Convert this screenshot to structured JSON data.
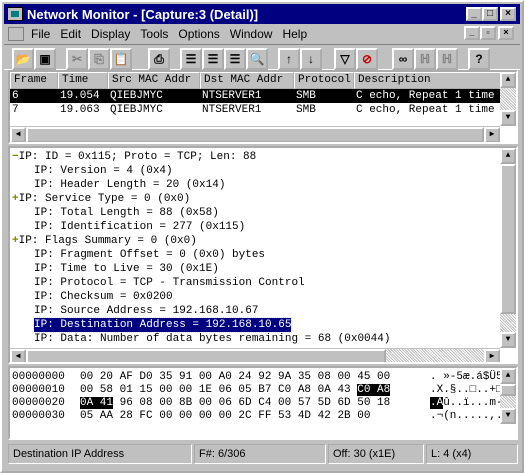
{
  "window": {
    "title": "Network Monitor - [Capture:3 (Detail)]"
  },
  "menu": [
    {
      "id": "file",
      "label": "File"
    },
    {
      "id": "edit",
      "label": "Edit"
    },
    {
      "id": "display",
      "label": "Display"
    },
    {
      "id": "tools",
      "label": "Tools"
    },
    {
      "id": "options",
      "label": "Options"
    },
    {
      "id": "window",
      "label": "Window"
    },
    {
      "id": "help",
      "label": "Help"
    }
  ],
  "toolbar_icons": [
    "open-icon",
    "save-icon",
    "cut-icon",
    "copy-icon",
    "paste-icon",
    "print-icon",
    "pane-summary-icon",
    "pane-detail-icon",
    "pane-hex-icon",
    "find-icon",
    "up-arrow-icon",
    "down-arrow-icon",
    "filter-icon",
    "stop-filter-icon",
    "binoculars-icon",
    "find-next-icon",
    "find-prev-icon",
    "help-icon"
  ],
  "summary": {
    "columns": [
      "Frame",
      "Time",
      "Src MAC Addr",
      "Dst MAC Addr",
      "Protocol",
      "Description"
    ],
    "rows": [
      {
        "frame": "6",
        "time": "19.054",
        "src": "QIEBJMYC",
        "dst": "NTSERVER1",
        "proto": "SMB",
        "desc": "C echo, Repeat 1 time",
        "selected": true
      },
      {
        "frame": "7",
        "time": "19.063",
        "src": "QIEBJMYC",
        "dst": "NTSERVER1",
        "proto": "SMB",
        "desc": "C echo, Repeat 1 time",
        "selected": false
      }
    ]
  },
  "detail": [
    {
      "marker": "minus",
      "text": "IP: ID = 0x115; Proto = TCP; Len: 88"
    },
    {
      "marker": "",
      "text": "IP: Version = 4 (0x4)"
    },
    {
      "marker": "",
      "text": "IP: Header Length = 20 (0x14)"
    },
    {
      "marker": "plus",
      "text": "IP: Service Type = 0 (0x0)"
    },
    {
      "marker": "",
      "text": "IP: Total Length = 88 (0x58)"
    },
    {
      "marker": "",
      "text": "IP: Identification = 277 (0x115)"
    },
    {
      "marker": "plus",
      "text": "IP: Flags Summary = 0 (0x0)"
    },
    {
      "marker": "",
      "text": "IP: Fragment Offset = 0 (0x0) bytes"
    },
    {
      "marker": "",
      "text": "IP: Time to Live = 30 (0x1E)"
    },
    {
      "marker": "",
      "text": "IP: Protocol = TCP - Transmission Control"
    },
    {
      "marker": "",
      "text": "IP: Checksum = 0x0200"
    },
    {
      "marker": "",
      "text": "IP: Source Address = 192.168.10.67"
    },
    {
      "marker": "",
      "text": "IP: Destination Address = 192.168.10.65",
      "selected": true
    },
    {
      "marker": "",
      "text": "IP: Data: Number of data bytes remaining = 68 (0x0044)"
    }
  ],
  "hex": [
    {
      "offset": "00000000",
      "pre": "00 20 AF D0 35 91 00 A0 24 92 9A 35 08 00 45 00",
      "hl": "",
      "post": "",
      "ascii_pre": ". »-5æ.á$Ü5..E.",
      "ascii_hl": "",
      "ascii_post": ""
    },
    {
      "offset": "00000010",
      "pre": "00 58 01 15 00 00 1E 06 05 B7 C0 A8 0A 43 ",
      "hl": "C0 A8",
      "post": "",
      "ascii_pre": ".X.§..□..+□└¿.C",
      "ascii_hl": "",
      "ascii_post": ""
    },
    {
      "offset": "00000020",
      "pre": "",
      "hl": "0A 41",
      "post": " 96 08 00 8B 00 06 6D C4 00 57 5D 6D 50 18",
      "ascii_pre": "",
      "ascii_hl": ".A",
      "ascii_post": "û..ï...m-.W]mP."
    },
    {
      "offset": "00000030",
      "pre": "05 AA 28 FC 00 00 00 00 2C FF 53 4D 42 2B 00",
      "hl": "",
      "post": "",
      "ascii_pre": ".¬(n.....,.SMB+.",
      "ascii_hl": "",
      "ascii_post": ""
    }
  ],
  "status": {
    "description": "Destination IP Address",
    "frame": "F#: 6/306",
    "offset": "Off: 30 (x1E)",
    "length": "L: 4 (x4)"
  }
}
